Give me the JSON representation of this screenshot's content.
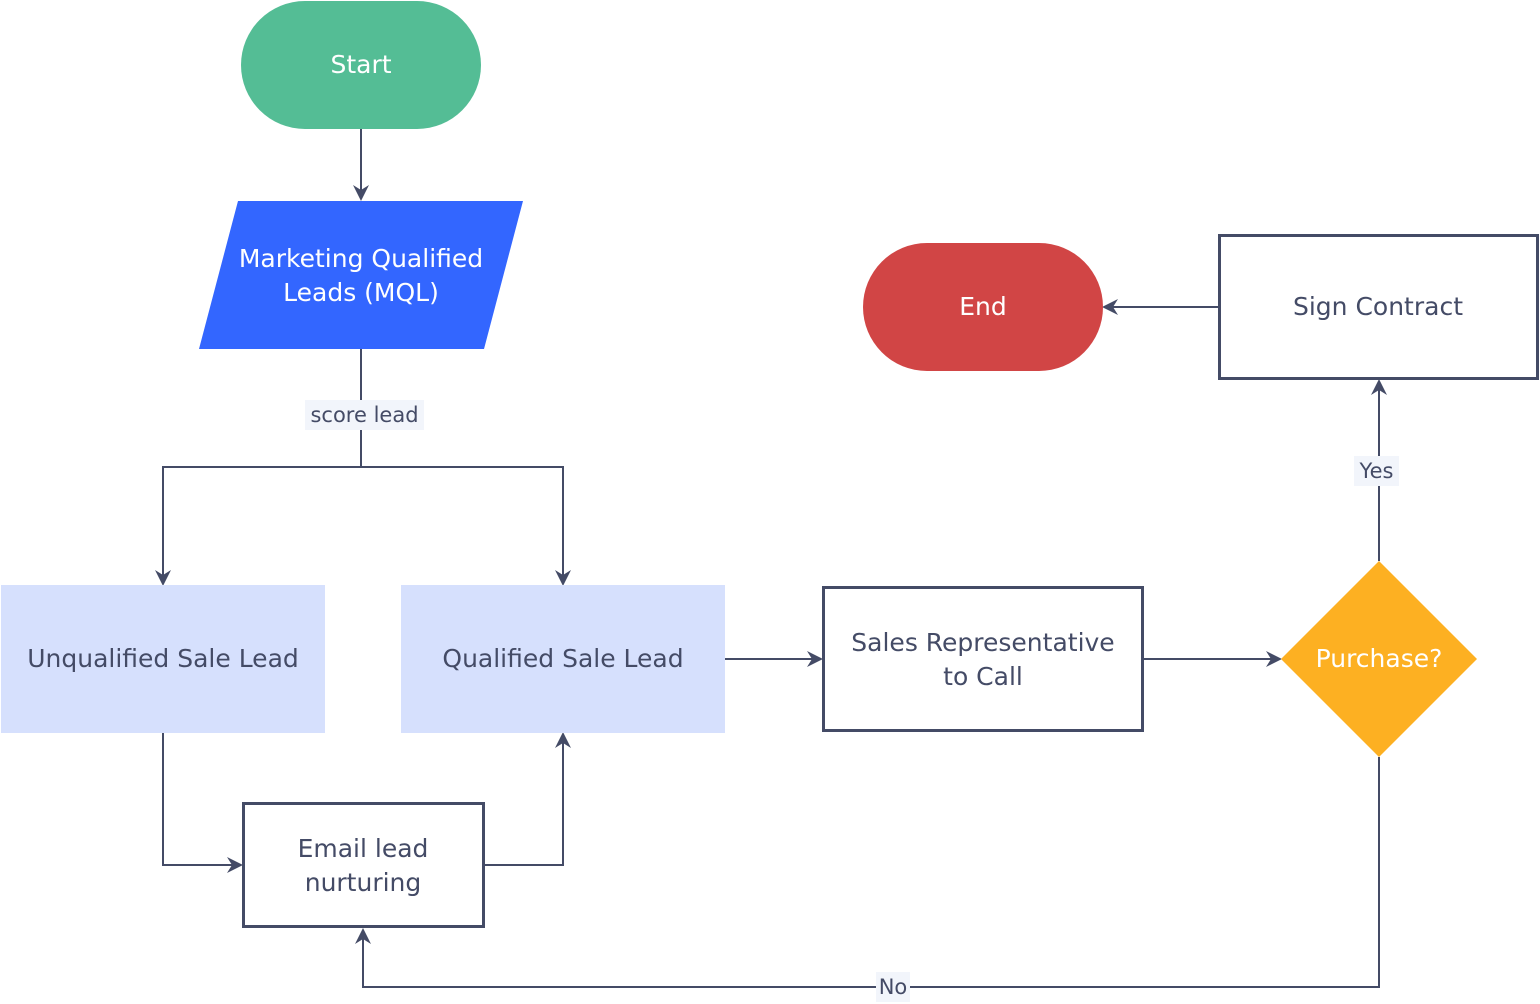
{
  "diagram": {
    "type": "flowchart",
    "colors": {
      "start": "#54bd95",
      "mql": "#3366ff",
      "lead_fill": "#d6e0fd",
      "end": "#d14545",
      "decision": "#fdb022",
      "stroke": "#444b66",
      "dark_text": "#444b66",
      "light_text": "#ffffff",
      "edge_label_bg": "#f2f5fb"
    },
    "nodes": {
      "start": {
        "shape": "terminator",
        "lines": [
          "Start"
        ]
      },
      "mql": {
        "shape": "parallelogram",
        "lines": [
          "Marketing Qualified",
          "Leads (MQL)"
        ]
      },
      "unqualified": {
        "shape": "rectangle",
        "lines": [
          "Unqualified Sale Lead"
        ]
      },
      "qualified": {
        "shape": "rectangle",
        "lines": [
          "Qualified Sale Lead"
        ]
      },
      "email": {
        "shape": "rectangle",
        "lines": [
          "Email lead",
          "nurturing"
        ]
      },
      "sales_rep": {
        "shape": "rectangle",
        "lines": [
          "Sales Representative",
          "to Call"
        ]
      },
      "purchase": {
        "shape": "diamond",
        "lines": [
          "Purchase?"
        ]
      },
      "sign": {
        "shape": "rectangle",
        "lines": [
          "Sign Contract"
        ]
      },
      "end": {
        "shape": "terminator",
        "lines": [
          "End"
        ]
      }
    },
    "edges": [
      {
        "from": "start",
        "to": "mql",
        "label": ""
      },
      {
        "from": "mql",
        "to": "unqualified",
        "label": "score lead"
      },
      {
        "from": "mql",
        "to": "qualified",
        "label": "score lead"
      },
      {
        "from": "unqualified",
        "to": "email",
        "label": ""
      },
      {
        "from": "email",
        "to": "qualified",
        "label": ""
      },
      {
        "from": "qualified",
        "to": "sales_rep",
        "label": ""
      },
      {
        "from": "sales_rep",
        "to": "purchase",
        "label": ""
      },
      {
        "from": "purchase",
        "to": "sign",
        "label": "Yes"
      },
      {
        "from": "purchase",
        "to": "email",
        "label": "No"
      },
      {
        "from": "sign",
        "to": "end",
        "label": ""
      }
    ],
    "edge_labels": {
      "score": "score lead",
      "yes": "Yes",
      "no": "No"
    }
  }
}
